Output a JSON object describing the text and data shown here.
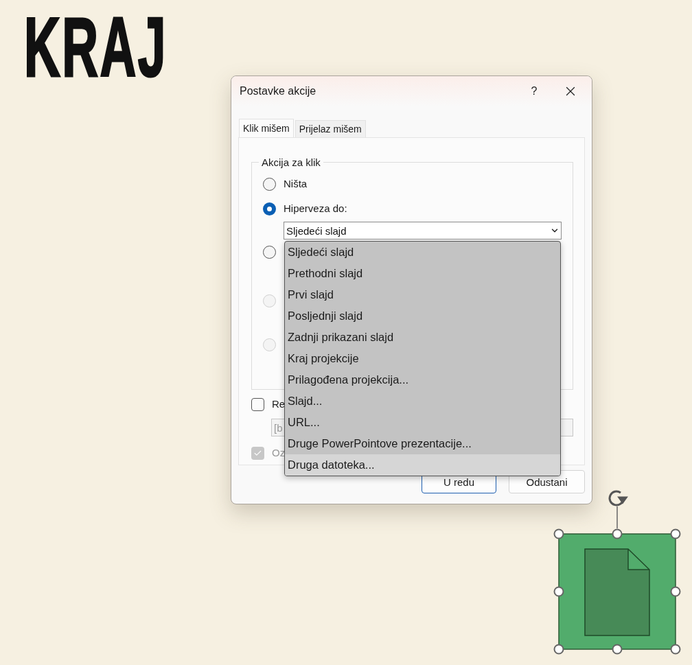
{
  "slide": {
    "title": "KRAJ"
  },
  "dialog": {
    "title": "Postavke akcije",
    "help": "?",
    "tabs": [
      {
        "label": "Klik mišem",
        "selected": true
      },
      {
        "label": "Prijelaz mišem",
        "selected": false
      }
    ],
    "group": {
      "title": "Akcija za klik",
      "radios": [
        {
          "label": "Ništa",
          "selected": false,
          "disabled": false
        },
        {
          "label": "Hiperveza do:",
          "selected": true,
          "disabled": false,
          "combo": {
            "value": "Sljedeći slajd",
            "expanded": true,
            "options": [
              {
                "label": "Sljedeći slajd",
                "highlighted": false
              },
              {
                "label": "Prethodni slajd",
                "highlighted": false
              },
              {
                "label": "Prvi slajd",
                "highlighted": false
              },
              {
                "label": "Posljednji slajd",
                "highlighted": false
              },
              {
                "label": "Zadnji prikazani slajd",
                "highlighted": false
              },
              {
                "label": "Kraj projekcije",
                "highlighted": false
              },
              {
                "label": "Prilagođena projekcija...",
                "highlighted": false
              },
              {
                "label": "Slajd...",
                "highlighted": false
              },
              {
                "label": "URL...",
                "highlighted": false
              },
              {
                "label": "Druge PowerPointove prezentacije...",
                "highlighted": false
              },
              {
                "label": "Druga datoteka...",
                "highlighted": true
              }
            ]
          }
        },
        {
          "selected": false,
          "disabled": false
        },
        {
          "selected": false,
          "disabled": true
        },
        {
          "selected": false,
          "disabled": true
        }
      ]
    },
    "sound": {
      "label": "Re",
      "checked": false,
      "disabled": false
    },
    "sound_field": {
      "value": "[b",
      "disabled": true
    },
    "highlight": {
      "label": "Oz",
      "checked": true,
      "disabled": true
    },
    "buttons": [
      {
        "label": "U redu",
        "default": true
      },
      {
        "label": "Odustani",
        "default": false
      }
    ]
  }
}
